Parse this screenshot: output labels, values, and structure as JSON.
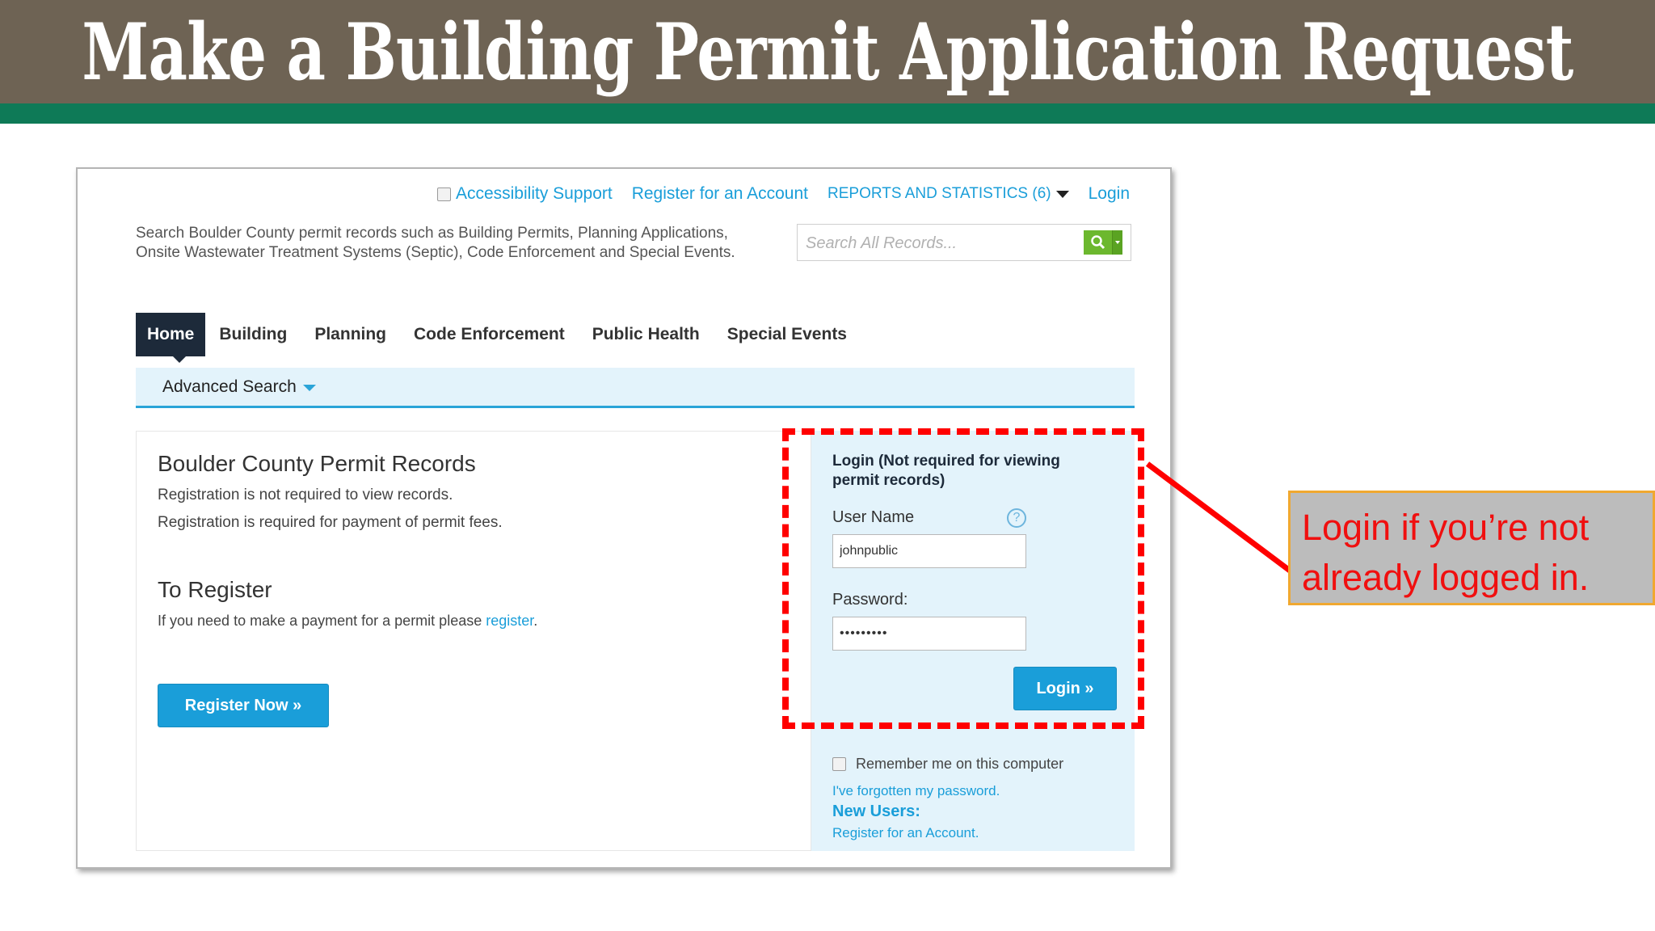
{
  "slide": {
    "title": "Make a Building Permit Application Request",
    "callout": "Login if you’re not already logged in.",
    "colors": {
      "banner": "#6e6354",
      "stripe": "#0e7a57",
      "callout_text": "#f00f0f",
      "dashed": "#ff0000"
    }
  },
  "topnav": {
    "accessibility": "Accessibility Support",
    "register": "Register for an Account",
    "reports": "REPORTS AND STATISTICS (6)",
    "login": "Login"
  },
  "intro": "Search Boulder County permit records such as Building Permits, Planning Applications, Onsite Wastewater Treatment Systems (Septic), Code Enforcement and Special Events.",
  "search": {
    "placeholder": "Search All Records..."
  },
  "tabs": [
    {
      "label": "Home"
    },
    {
      "label": "Building"
    },
    {
      "label": "Planning"
    },
    {
      "label": "Code Enforcement"
    },
    {
      "label": "Public Health"
    },
    {
      "label": "Special Events"
    }
  ],
  "subnav": {
    "advanced_search": "Advanced Search"
  },
  "main": {
    "heading": "Boulder County Permit Records",
    "line1": "Registration is not required to view records.",
    "line2": "Registration is required for payment of permit fees.",
    "register_heading": "To Register",
    "register_text": "If you need to make a payment for a permit please ",
    "register_link": "register",
    "register_period": ".",
    "register_button": "Register Now »"
  },
  "login": {
    "header": "Login (Not required for viewing permit records)",
    "username_label": "User Name",
    "username_value": "johnpublic",
    "password_label": "Password:",
    "password_value": "•••••••••",
    "button": "Login »",
    "remember": "Remember me on this computer",
    "forgot": "I've forgotten my password.",
    "new_users": "New Users:",
    "register": "Register for an Account."
  }
}
